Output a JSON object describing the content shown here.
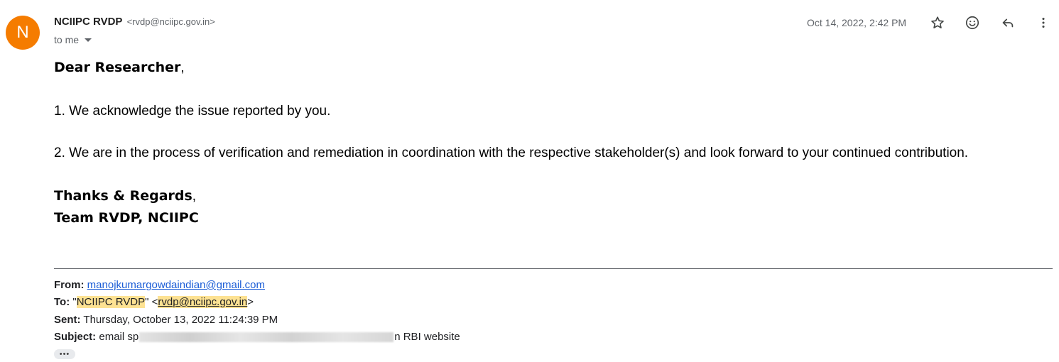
{
  "header": {
    "avatar_letter": "N",
    "avatar_color": "#f57c00",
    "sender_name": "NCIIPC RVDP",
    "sender_email": "<rvdp@nciipc.gov.in>",
    "recipient": "to me",
    "date": "Oct 14, 2022, 2:42 PM",
    "icons": [
      "star-icon",
      "emoji-icon",
      "reply-icon",
      "more-vert-icon"
    ]
  },
  "body": {
    "greeting_bold": "Dear Researcher",
    "greeting_punct": ",",
    "line1": "1. We acknowledge the issue reported by you.",
    "line2": "2. We are in the process of verification and remediation in coordination with the respective stakeholder(s) and look forward to your continued contribution.",
    "signoff_bold": "Thanks & Regards",
    "signoff_punct": ",",
    "team": "Team RVDP, NCIIPC"
  },
  "quoted": {
    "from_label": "From:",
    "from_value": "manojkumargowdaindian@gmail.com",
    "to_label": "To:",
    "to_quote_open": "\"",
    "to_name": "NCIIPC RVDP",
    "to_quote_close": "\" <",
    "to_email": "rvdp@nciipc.gov.in",
    "to_end": ">",
    "sent_label": "Sent:",
    "sent_value": "Thursday, October 13, 2022 11:24:39 PM",
    "subject_label": "Subject:",
    "subject_start": "email sp",
    "subject_end": "n RBI website",
    "more_label": "•••"
  },
  "colors": {
    "link": "#1a5cd6",
    "highlight": "#fde293",
    "muted": "#5f6368"
  }
}
